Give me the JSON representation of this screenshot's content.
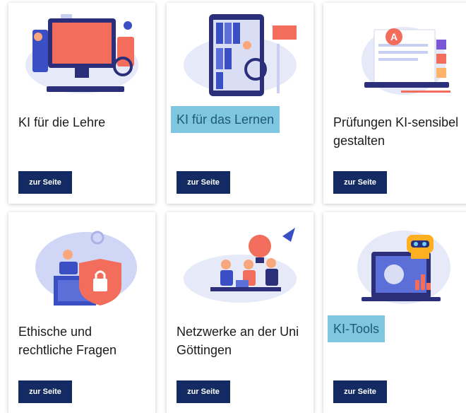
{
  "cards": [
    {
      "title": "KI für die Lehre",
      "button": "zur Seite"
    },
    {
      "title": "KI für das Lernen",
      "button": "zur Seite"
    },
    {
      "title": "Prüfungen KI-sensibel gestalten",
      "button": "zur Seite"
    },
    {
      "title": "Ethische und rechtliche Fragen",
      "button": "zur Seite"
    },
    {
      "title": "Netzwerke an der Uni Göttingen",
      "button": "zur Seite"
    },
    {
      "title": "KI-Tools",
      "button": "zur Seite"
    }
  ],
  "colors": {
    "button": "#142a63",
    "highlight": "#7fc6e1",
    "accent": "#f26d5b",
    "illustration_blue": "#3a4fc4"
  }
}
